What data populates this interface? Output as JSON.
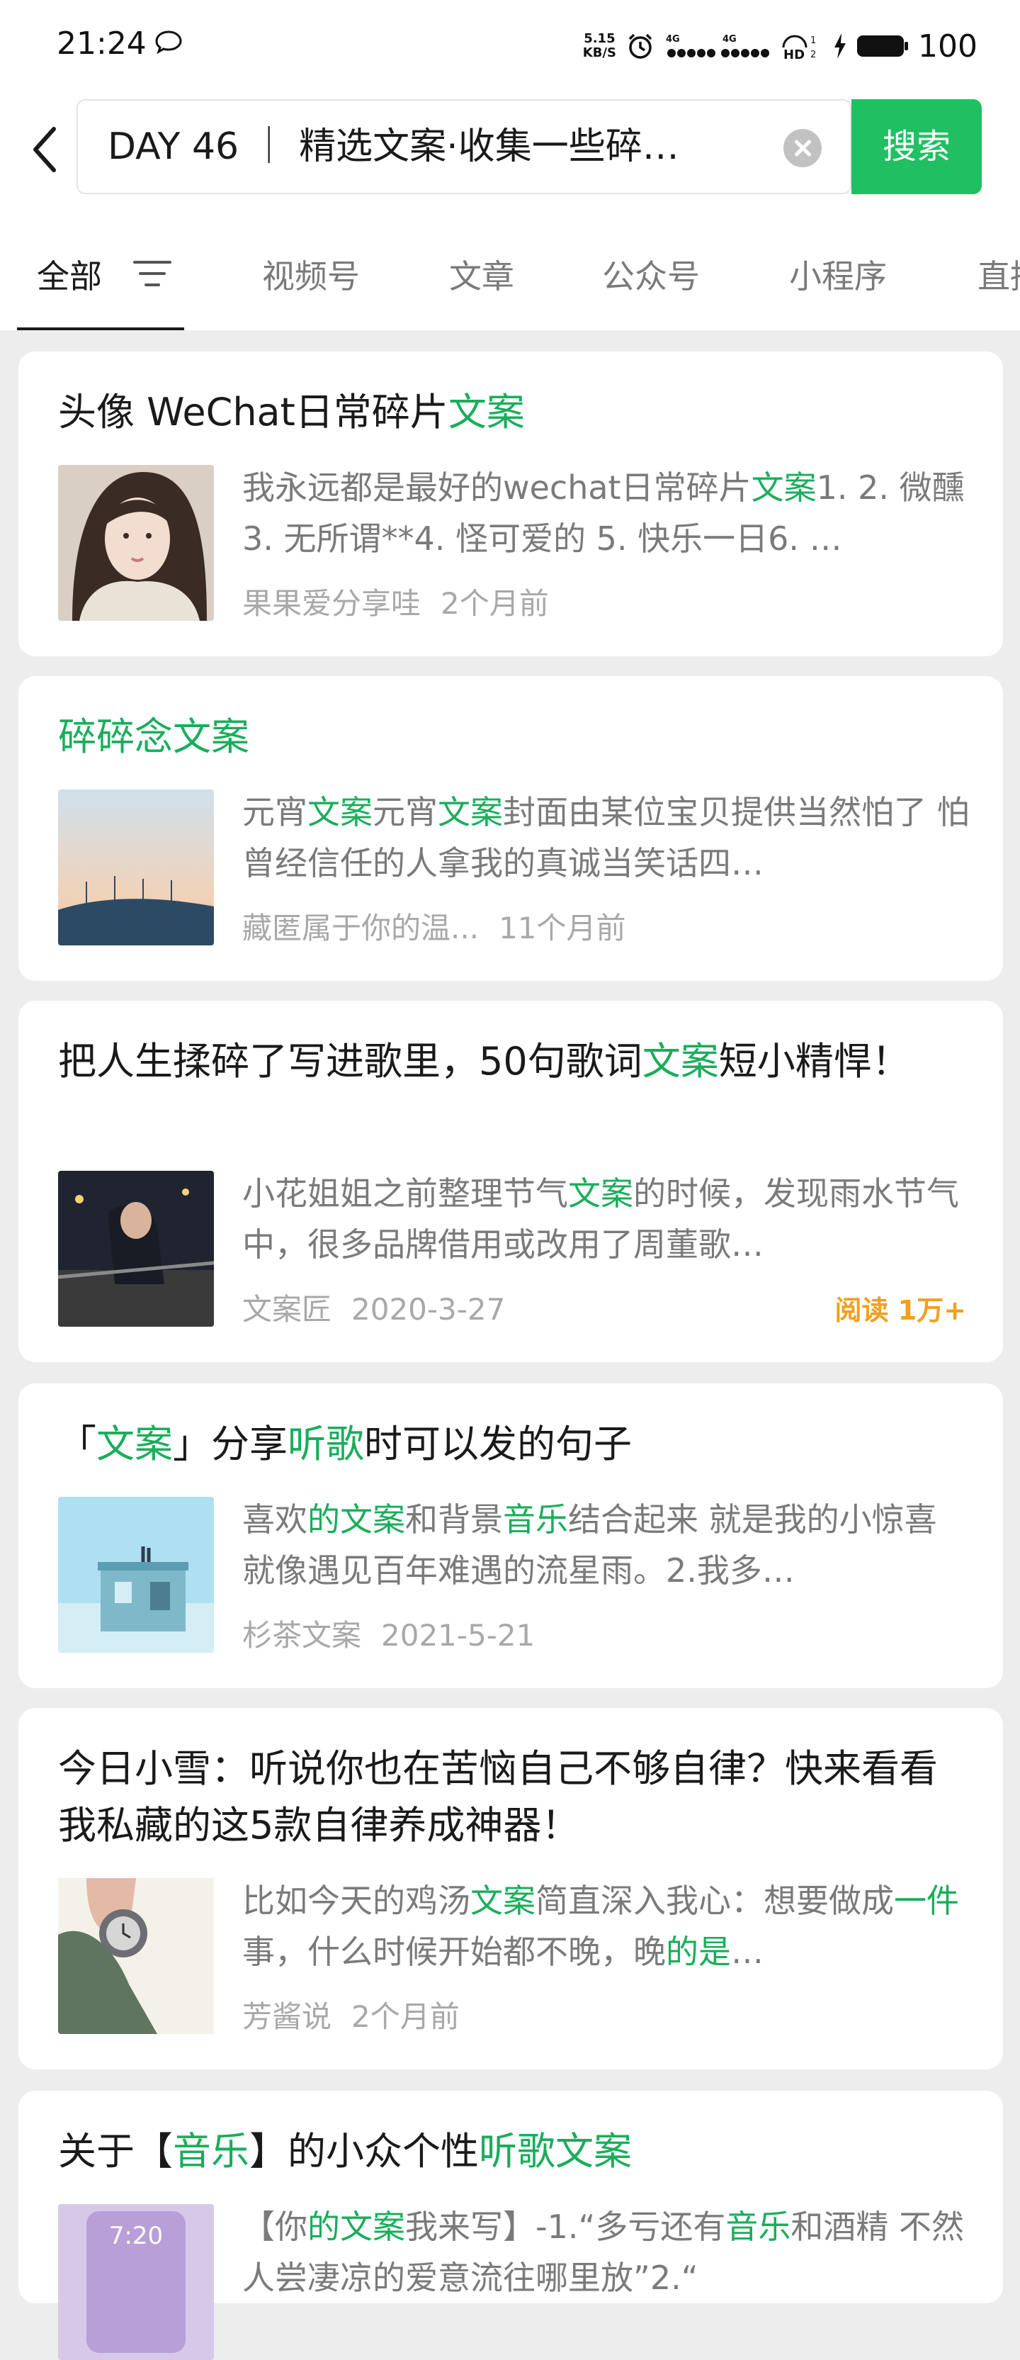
{
  "status_bar": {
    "time": "21:24",
    "network_speed_value": "5.15",
    "network_speed_unit": "KB/S",
    "battery": "100",
    "icons": [
      "message-bubble-icon",
      "alarm-icon",
      "signal-4g-icon",
      "hd-icon",
      "charging-icon",
      "battery-icon"
    ]
  },
  "search": {
    "query": "DAY 46 ｜ 精选文案·收集一些碎…",
    "button_label": "搜索"
  },
  "tabs": [
    {
      "label": "全部",
      "active": true
    },
    {
      "label": "视频号",
      "active": false
    },
    {
      "label": "文章",
      "active": false
    },
    {
      "label": "公众号",
      "active": false
    },
    {
      "label": "小程序",
      "active": false
    },
    {
      "label": "直播",
      "active": false
    }
  ],
  "colors": {
    "accent_green": "#20c062",
    "highlight_green": "#1aad5b",
    "read_orange": "#f0a020"
  },
  "results": [
    {
      "title_parts": [
        {
          "t": "头像 WeChat日常碎片",
          "h": false
        },
        {
          "t": "文案",
          "h": true
        }
      ],
      "snippet_parts": [
        {
          "t": "我永远都是最好的wechat日常碎片",
          "h": false
        },
        {
          "t": "文案",
          "h": true
        },
        {
          "t": "1. 2. 微醺 3. 无所谓**4. 怪可爱的 5. 快乐一日6. …",
          "h": false
        }
      ],
      "source": "果果爱分享哇",
      "time": "2个月前",
      "reads": ""
    },
    {
      "title_parts": [
        {
          "t": "碎碎念文案",
          "h": true
        }
      ],
      "snippet_parts": [
        {
          "t": "元宵",
          "h": false
        },
        {
          "t": "文案",
          "h": true
        },
        {
          "t": "元宵",
          "h": false
        },
        {
          "t": "文案",
          "h": true
        },
        {
          "t": "封面由某位宝贝提供当然怕了 怕曾经信任的人拿我的真诚当笑话四…",
          "h": false
        }
      ],
      "source": "藏匿属于你的温...",
      "time": "11个月前",
      "reads": ""
    },
    {
      "title_parts": [
        {
          "t": "把人生揉碎了写进歌里，50句歌词",
          "h": false
        },
        {
          "t": "文案",
          "h": true
        },
        {
          "t": "短小精悍！",
          "h": false
        }
      ],
      "snippet_parts": [
        {
          "t": "小花姐姐之前整理节气",
          "h": false
        },
        {
          "t": "文案",
          "h": true
        },
        {
          "t": "的时候，发现雨水节气中，很多品牌借用或改用了周董歌…",
          "h": false
        }
      ],
      "source": "文案匠",
      "time": "2020-3-27",
      "reads": "阅读 1万+"
    },
    {
      "title_parts": [
        {
          "t": "「",
          "h": false
        },
        {
          "t": "文案",
          "h": true
        },
        {
          "t": "」分享",
          "h": false
        },
        {
          "t": "听歌",
          "h": true
        },
        {
          "t": "时可以发的句子",
          "h": false
        }
      ],
      "snippet_parts": [
        {
          "t": "喜欢",
          "h": false
        },
        {
          "t": "的文案",
          "h": true
        },
        {
          "t": "和背景",
          "h": false
        },
        {
          "t": "音乐",
          "h": true
        },
        {
          "t": "结合起来 就是我的小惊喜 就像遇见百年难遇的流星雨。2.我多…",
          "h": false
        }
      ],
      "source": "杉茶文案",
      "time": "2021-5-21",
      "reads": ""
    },
    {
      "title_parts": [
        {
          "t": "今日小雪：听说你也在苦恼自己不够自律？快来看看我私藏的这5款自律养成神器！",
          "h": false
        }
      ],
      "snippet_parts": [
        {
          "t": "比如今天的鸡汤",
          "h": false
        },
        {
          "t": "文案",
          "h": true
        },
        {
          "t": "简直深入我心：想要做成",
          "h": false
        },
        {
          "t": "一件",
          "h": true
        },
        {
          "t": "事，什么时候开始都不晚，晚",
          "h": false
        },
        {
          "t": "的是",
          "h": true
        },
        {
          "t": "…",
          "h": false
        }
      ],
      "source": "芳酱说",
      "time": "2个月前",
      "reads": ""
    },
    {
      "title_parts": [
        {
          "t": "关于【",
          "h": false
        },
        {
          "t": "音乐",
          "h": true
        },
        {
          "t": "】的小众个性",
          "h": false
        },
        {
          "t": "听歌文案",
          "h": true
        }
      ],
      "snippet_parts": [
        {
          "t": "【你",
          "h": false
        },
        {
          "t": "的文案",
          "h": true
        },
        {
          "t": "我来写】-1.“多亏还有",
          "h": false
        },
        {
          "t": "音乐",
          "h": true
        },
        {
          "t": "和酒精 不然人尝凄凉的爱意流往哪里放”2.“",
          "h": false
        }
      ],
      "source": "",
      "time": "",
      "reads": "",
      "thumb_text": "7:20"
    }
  ]
}
